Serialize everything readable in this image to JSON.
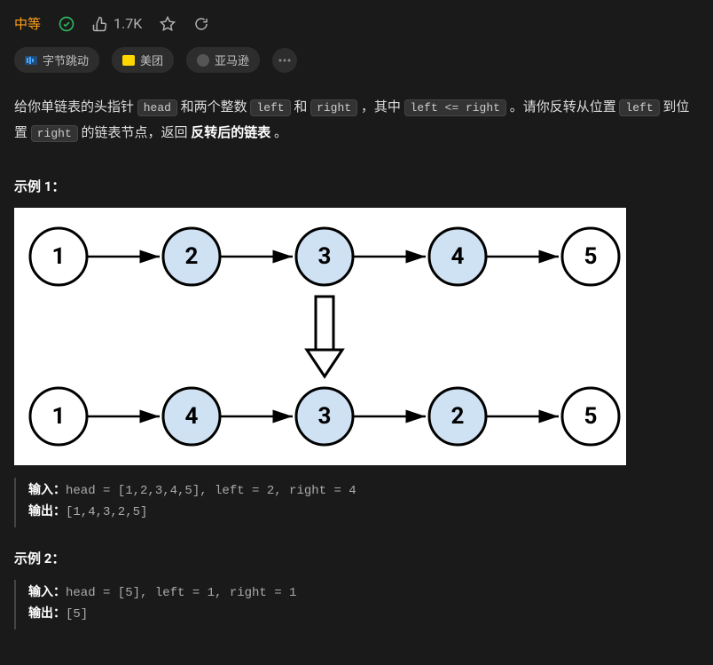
{
  "header": {
    "difficulty": "中等",
    "likes": "1.7K"
  },
  "tags": {
    "bytedance": "字节跳动",
    "meituan": "美团",
    "amazon": "亚马逊"
  },
  "desc": {
    "t1": "给你单链表的头指针 ",
    "c1": "head",
    "t2": " 和两个整数 ",
    "c2": "left",
    "t3": " 和 ",
    "c3": "right",
    "t4": " ，其中 ",
    "c4": "left <= right",
    "t5": " 。请你反转从位置 ",
    "c5": "left",
    "t6": " 到位置 ",
    "c6": "right",
    "t7": " 的链表节点，返回 ",
    "b1": "反转后的链表",
    "t8": " 。"
  },
  "example1": {
    "title": "示例 1：",
    "input_label": "输入：",
    "input": "head = [1,2,3,4,5], left = 2, right = 4",
    "output_label": "输出：",
    "output": "[1,4,3,2,5]",
    "nodes_top": [
      "1",
      "2",
      "3",
      "4",
      "5"
    ],
    "nodes_bottom": [
      "1",
      "4",
      "3",
      "2",
      "5"
    ]
  },
  "example2": {
    "title": "示例 2：",
    "input_label": "输入：",
    "input": "head = [5], left = 1, right = 1",
    "output_label": "输出：",
    "output": "[5]"
  }
}
